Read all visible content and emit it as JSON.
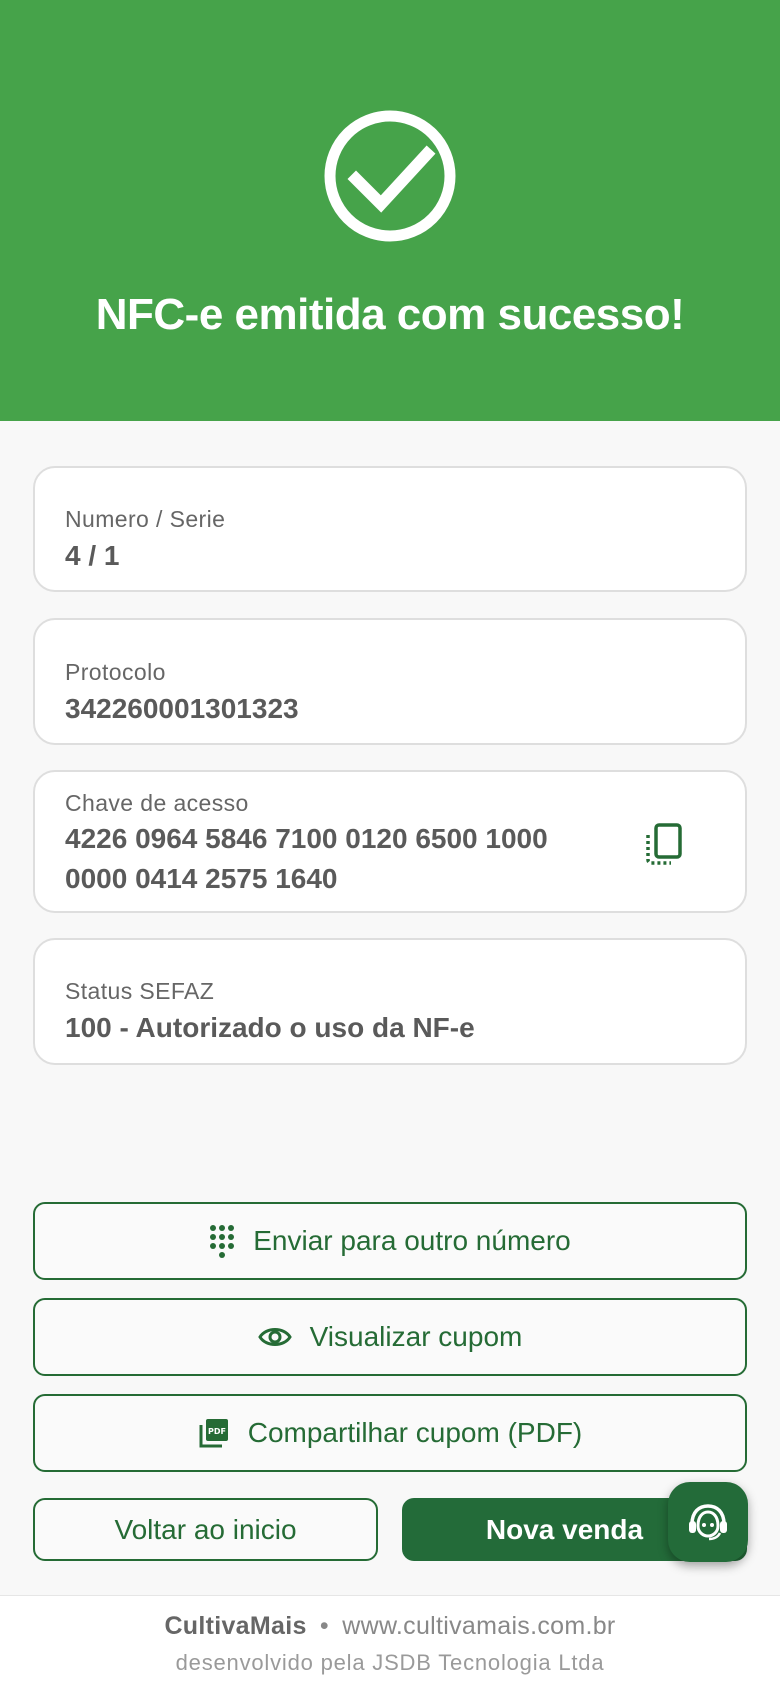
{
  "header": {
    "title": "NFC-e emitida com sucesso!",
    "icon": "check-circle-icon",
    "color": "#46a34a"
  },
  "details": {
    "numero_serie": {
      "label": "Numero / Serie",
      "value": "4 / 1"
    },
    "protocolo": {
      "label": "Protocolo",
      "value": "342260001301323"
    },
    "chave": {
      "label": "Chave de acesso",
      "value_line1": "4226 0964 5846 7100 0120 6500 1000",
      "value_line2": "0000 0414 2575 1640",
      "icon": "copy-icon"
    },
    "status": {
      "label": "Status SEFAZ",
      "value": "100 - Autorizado o uso da NF-e"
    }
  },
  "actions": {
    "send_other_number": {
      "label": "Enviar para outro número",
      "icon": "dialpad-icon"
    },
    "view_receipt": {
      "label": "Visualizar cupom",
      "icon": "eye-icon"
    },
    "share_pdf": {
      "label": "Compartilhar cupom (PDF)",
      "icon": "pdf-icon"
    },
    "back_home": {
      "label": "Voltar ao inicio"
    },
    "new_sale": {
      "label": "Nova venda"
    },
    "support": {
      "icon": "support-agent-icon"
    }
  },
  "footer": {
    "brand": "CultivaMais",
    "separator": "•",
    "url": "www.cultivamais.com.br",
    "credit": "desenvolvido pela JSDB Tecnologia Ltda"
  },
  "colors": {
    "primary_dark": "#236b39",
    "outline": "#256b35"
  }
}
